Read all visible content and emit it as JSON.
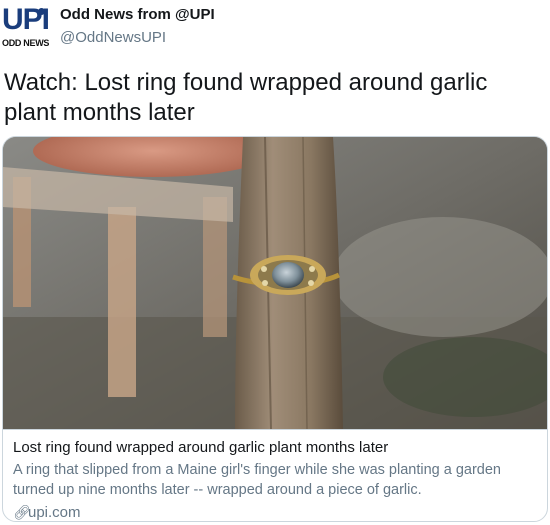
{
  "account": {
    "display_name": "Odd News from @UPI",
    "handle": "@OddNewsUPI",
    "avatar_logo": "UPI",
    "avatar_tagline": "ODD NEWS"
  },
  "tweet": {
    "text": "Watch: Lost ring found wrapped around garlic plant months later"
  },
  "card": {
    "title": "Lost ring found wrapped around garlic plant months later",
    "description": "A ring that slipped from a Maine girl's finger while she was planting a garden turned up nine months later -- wrapped around a piece of garlic.",
    "domain": "upi.com",
    "domain_icon": "link-icon"
  },
  "colors": {
    "brand": "#1a3d7c",
    "text_primary": "#14171a",
    "text_secondary": "#657786",
    "border": "#ccd6dd"
  }
}
